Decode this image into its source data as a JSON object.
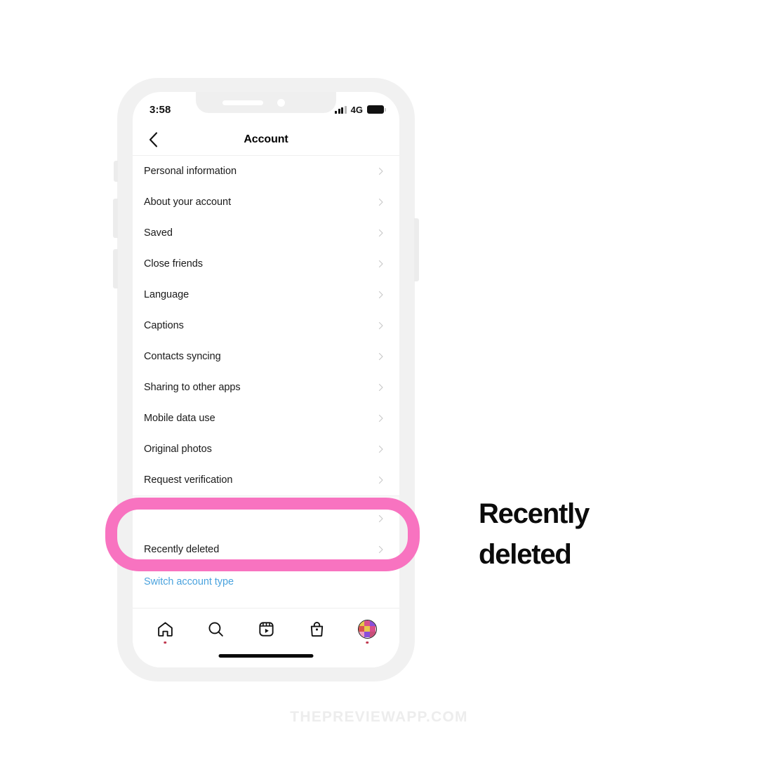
{
  "status_bar": {
    "time": "3:58",
    "network": "4G",
    "signal_icon": "signal-bars-icon",
    "battery_icon": "battery-full-icon"
  },
  "header": {
    "title": "Account",
    "back_icon": "chevron-left-icon"
  },
  "settings_list": {
    "chevron_icon": "chevron-right-icon",
    "items": [
      {
        "label": "Personal information"
      },
      {
        "label": "About your account"
      },
      {
        "label": "Saved"
      },
      {
        "label": "Close friends"
      },
      {
        "label": "Language"
      },
      {
        "label": "Captions"
      },
      {
        "label": "Contacts syncing"
      },
      {
        "label": "Sharing to other apps"
      },
      {
        "label": "Mobile data use"
      },
      {
        "label": "Original photos"
      },
      {
        "label": "Request verification"
      }
    ],
    "bottom_items": [
      {
        "label": "",
        "obscured": true
      },
      {
        "label": "Recently deleted",
        "highlighted": true
      }
    ]
  },
  "switch_account": {
    "label": "Switch account type",
    "color": "#4ba3de"
  },
  "tab_bar": {
    "items": [
      {
        "icon": "home-icon",
        "has_dot": true
      },
      {
        "icon": "search-icon",
        "has_dot": false
      },
      {
        "icon": "reels-icon",
        "has_dot": false
      },
      {
        "icon": "shop-bag-icon",
        "has_dot": false
      },
      {
        "icon": "profile-avatar-icon",
        "has_dot": true
      }
    ],
    "avatar_colors": [
      "#e8c84a",
      "#d94f8a",
      "#8a4fd9",
      "#d9534f",
      "#e8c84a",
      "#d94f8a",
      "#f0a0c0",
      "#8a4fd9",
      "#c94f7a"
    ]
  },
  "annotation": {
    "line1": "Recently",
    "line2": "deleted"
  },
  "highlight": {
    "color": "#f873c0",
    "target": "Recently deleted"
  },
  "watermark": {
    "text": "THEPREVIEWAPP.COM"
  }
}
